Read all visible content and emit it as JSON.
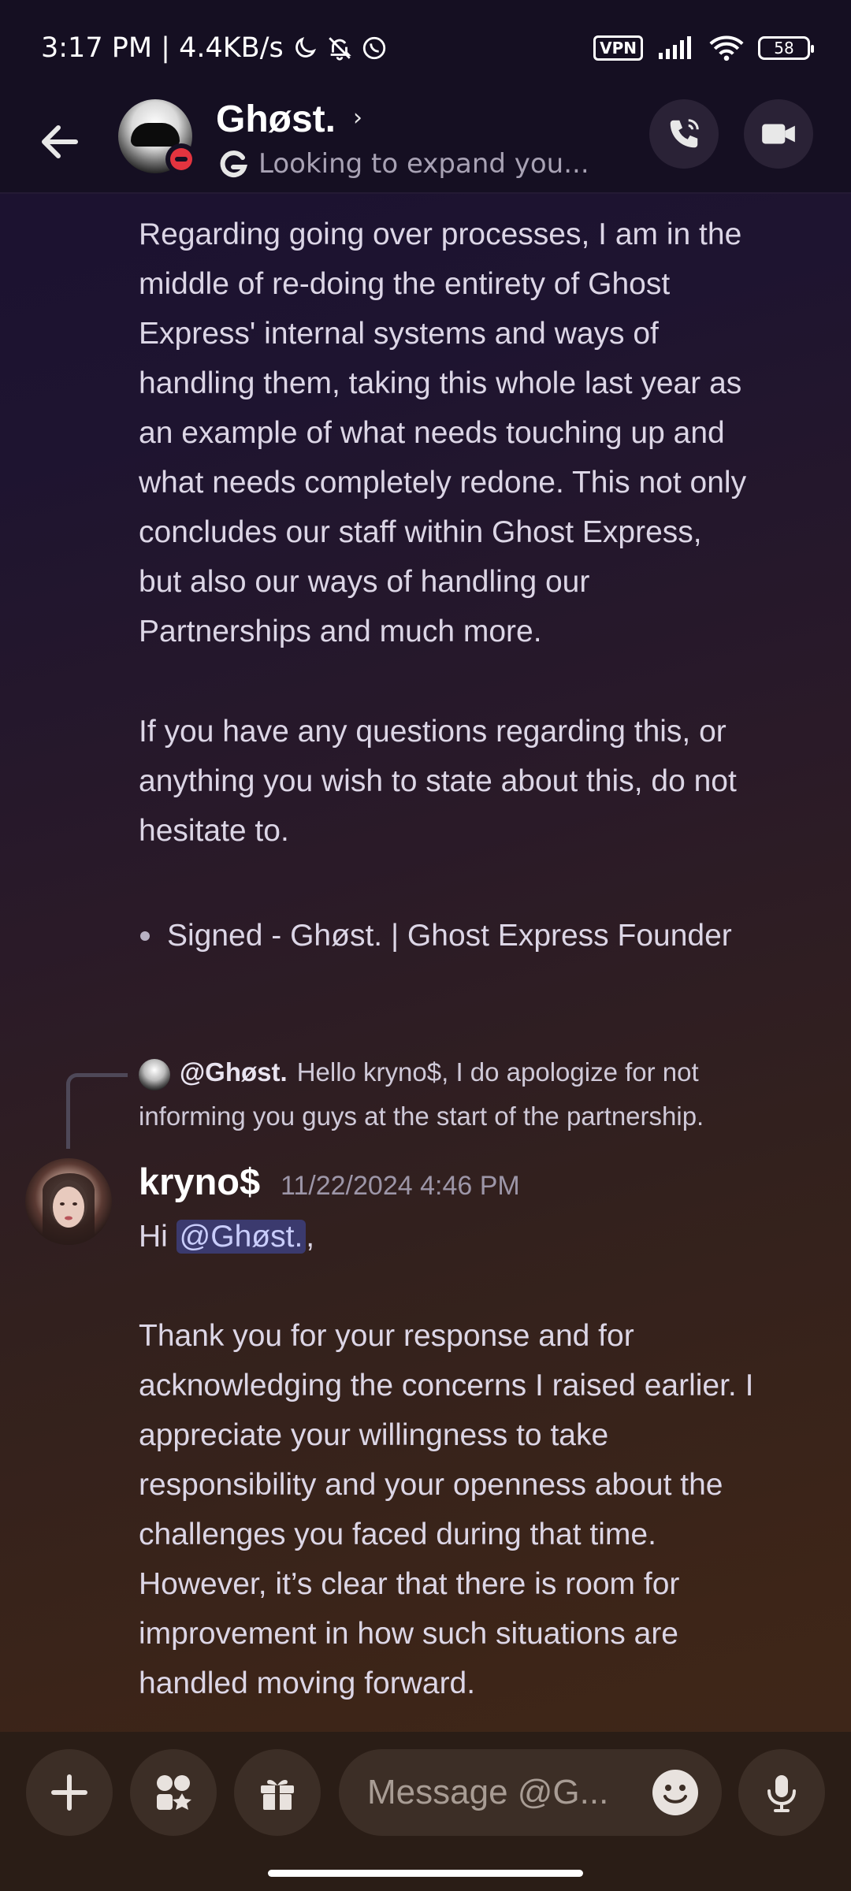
{
  "status_bar": {
    "time_speed": "3:17 PM | 4.4KB/s",
    "vpn": "VPN",
    "battery": "58"
  },
  "header": {
    "title": "Ghøst.",
    "status": "Looking to expand you..."
  },
  "messages": {
    "prev_para1_lines": [
      "Regarding going over processes, I am in the",
      "middle of re-doing the entirety of Ghost",
      "Express' internal systems and ways of",
      "handling them, taking this whole last year as",
      "an example of what needs touching up and",
      "what needs completely redone. This not only",
      "concludes our staff within Ghost Express,",
      "but also our ways of handling our",
      "Partnerships and much more."
    ],
    "prev_para2_lines": [
      "If you have any questions regarding this, or",
      "anything you wish to state about this, do not",
      "hesitate to."
    ],
    "prev_bullet": "Signed - Ghøst. | Ghost Express Founder",
    "reply": {
      "author": "@Ghøst.",
      "line1": "Hello kryno$,   I do apologize for not",
      "line2": "informing you guys at the start of the partnership."
    },
    "current": {
      "author": "kryno$",
      "timestamp": "11/22/2024 4:46 PM",
      "greeting": "Hi ",
      "mention": "@Ghøst.",
      "greeting_end": ",",
      "body_lines": [
        "Thank you for your response and for",
        "acknowledging the concerns I raised earlier. I",
        "appreciate your willingness to take",
        "responsibility and your openness about the",
        "challenges you faced during that time.",
        "However, it’s clear that there is room for",
        "improvement in how such situations are",
        "handled moving forward."
      ]
    }
  },
  "composer": {
    "placeholder": "Message @G..."
  },
  "colors": {
    "mention_bg": "#3b3a6e",
    "dnd_red": "#e3343f"
  }
}
